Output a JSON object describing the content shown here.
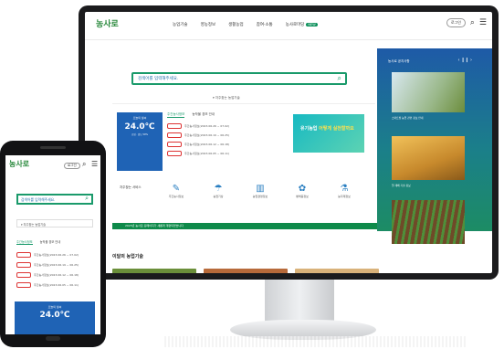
{
  "desktop": {
    "logo_text": "농사로",
    "nav": [
      "농업기술",
      "영농정보",
      "생활농업",
      "참여·소통",
      "농사로마당"
    ],
    "nav_new_badge": "NEW",
    "login_label": "로그인",
    "search_placeholder": "검색어를 입력해주세요.",
    "search_toggle": "▾ 자주찾는 농업기술",
    "weather": {
      "title": "오늘의 날씨",
      "temp": "24.0℃",
      "detail": "흐림 · 습도 59%"
    },
    "news_tabs": [
      "주간농사정보",
      "농작물 경보 안내"
    ],
    "news_items": [
      {
        "label": "주간농사정보(2023.06.26 ~ 07.02)"
      },
      {
        "label": "주간농사정보(2023.06.19 ~ 06.25)"
      },
      {
        "label": "주간농사정보(2023.06.12 ~ 06.18)"
      },
      {
        "label": "주간농사정보(2023.06.05 ~ 06.11)"
      }
    ],
    "banner_text": "유기농업 ",
    "banner_highlight": "어떻게 실천할까요",
    "services_label": "자주찾는 서비스",
    "services": [
      "주간농사정보",
      "농업기상",
      "농업경영정보",
      "병해충정보",
      "농자재정보"
    ],
    "ticker": "2023년 농사로 홈페이지가 새롭게 개편되었습니다",
    "side_title": "농사로 공지사항",
    "side_arrows": "‹ ❙❙ ›",
    "side_captions": [
      "스마트팜 농업 관련 정보 안내",
      "밀 재배 기술 정보"
    ],
    "section2_title": "이달의 농업기술",
    "thumb_colors": [
      "#6b8f3a",
      "#b76a3a",
      "#d9b27a",
      "#9ac26a"
    ]
  },
  "phone": {
    "logo_text": "농사로",
    "login_label": "로그인",
    "search_placeholder": "검색어를 입력해주세요.",
    "select_label": "▾ 자주찾는 농업기술",
    "tabs": [
      "주간농사정보",
      "농작물 경보 안내"
    ],
    "news_items": [
      {
        "label": "주간농사정보(2023.06.26 ~ 07.02)"
      },
      {
        "label": "주간농사정보(2023.06.19 ~ 06.25)"
      },
      {
        "label": "주간농사정보(2023.06.12 ~ 06.18)"
      },
      {
        "label": "주간농사정보(2023.06.05 ~ 06.11)"
      }
    ],
    "weather": {
      "title": "오늘의 날씨",
      "temp": "24.0℃"
    }
  }
}
